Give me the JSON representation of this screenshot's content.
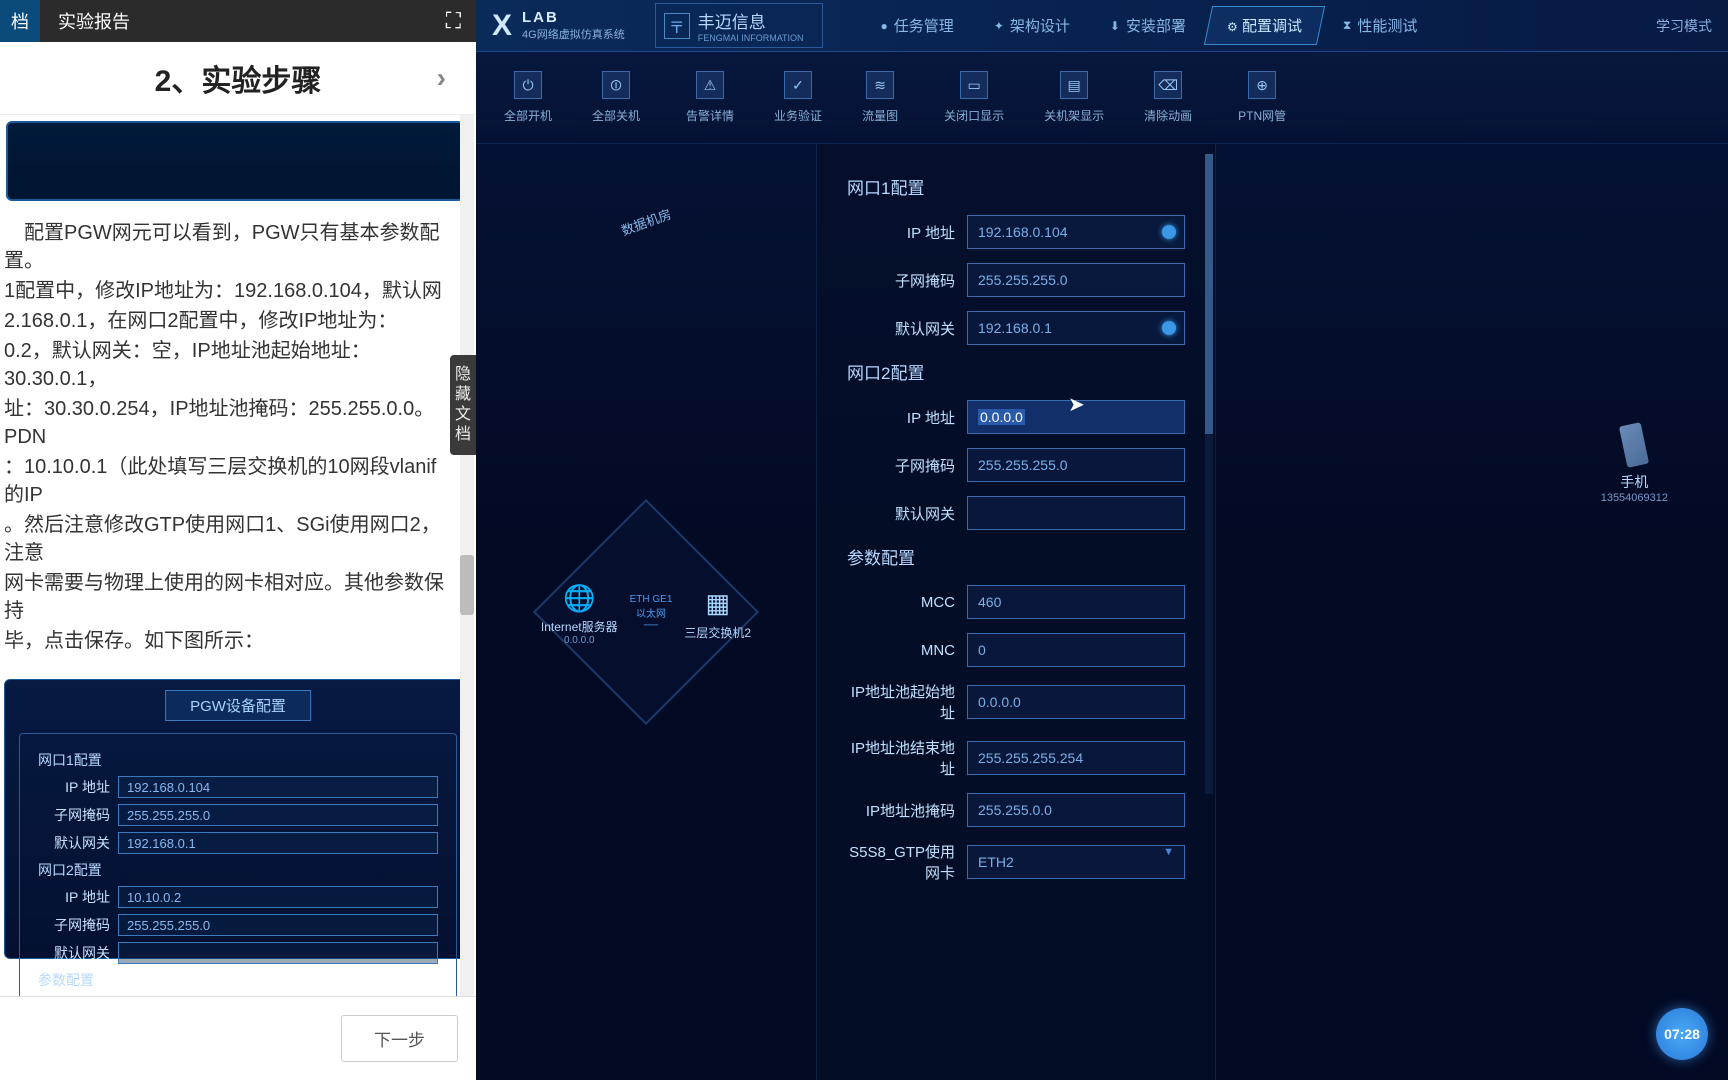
{
  "doc": {
    "tab1": "档",
    "tab2": "实验报告",
    "section_title": "2、实验步骤",
    "body_lines": [
      "　配置PGW网元可以看到，PGW只有基本参数配置。",
      "1配置中，修改IP地址为：192.168.0.104，默认网",
      "2.168.0.1，在网口2配置中，修改IP地址为：",
      "0.2，默认网关：空，IP地址池起始地址：30.30.0.1，",
      "址：30.30.0.254，IP地址池掩码：255.255.0.0。PDN",
      "：10.10.0.1（此处填写三层交换机的10网段vlanif的IP",
      "。然后注意修改GTP使用网口1、SGi使用网口2，注意",
      "网卡需要与物理上使用的网卡相对应。其他参数保持",
      "",
      "毕，点击保存。如下图所示："
    ],
    "img": {
      "title": "PGW设备配置",
      "s1": "网口1配置",
      "s2": "网口2配置",
      "s3": "参数配置",
      "ip_label": "IP 地址",
      "mask_label": "子网掩码",
      "gw_label": "默认网关",
      "r1_ip": "192.168.0.104",
      "r1_mask": "255.255.255.0",
      "r1_gw": "192.168.0.1",
      "r2_ip": "10.10.0.2",
      "r2_mask": "255.255.255.0",
      "r2_gw": ""
    },
    "hide_tab": "隐藏文档",
    "next_btn": "下一步"
  },
  "sim": {
    "logo_lab": "LAB",
    "logo_sub": "4G网络虚拟仿真系统",
    "company": "丰迈信息",
    "company_sub": "FENGMAI INFORMATION",
    "nav": {
      "n1": "任务管理",
      "n2": "架构设计",
      "n3": "安装部署",
      "n4": "配置调试",
      "n5": "性能测试"
    },
    "mode": "学习模式",
    "toolbar": {
      "t1": "全部开机",
      "t2": "全部关机",
      "t3": "告警详情",
      "t4": "业务验证",
      "t5": "流量图",
      "t6": "关闭口显示",
      "t7": "关机架显示",
      "t8": "清除动画",
      "t9": "PTN网管"
    },
    "topo": {
      "title": "数据机房",
      "node1": "Internet服务器",
      "node1_sub": "0.0.0.0",
      "link": "ETH GE1",
      "link2": "以太网",
      "node2": "三层交换机2"
    },
    "config": {
      "s1_title": "网口1配置",
      "s2_title": "网口2配置",
      "s3_title": "参数配置",
      "ip_label": "IP 地址",
      "mask_label": "子网掩码",
      "gw_label": "默认网关",
      "mcc_label": "MCC",
      "mnc_label": "MNC",
      "pool_start_label": "IP地址池起始地址",
      "pool_end_label": "IP地址池结束地址",
      "pool_mask_label": "IP地址池掩码",
      "s5s8_label": "S5S8_GTP使用网卡",
      "p1_ip": "192.168.0.104",
      "p1_mask": "255.255.255.0",
      "p1_gw": "192.168.0.1",
      "p2_ip": "0.0.0.0",
      "p2_mask": "255.255.255.0",
      "p2_gw": "",
      "mcc": "460",
      "mnc": "0",
      "pool_start": "0.0.0.0",
      "pool_end": "255.255.255.254",
      "pool_mask": "255.255.0.0",
      "s5s8": "ETH2"
    },
    "phone": {
      "label": "手机",
      "number": "13554069312"
    },
    "time": "07:28"
  }
}
